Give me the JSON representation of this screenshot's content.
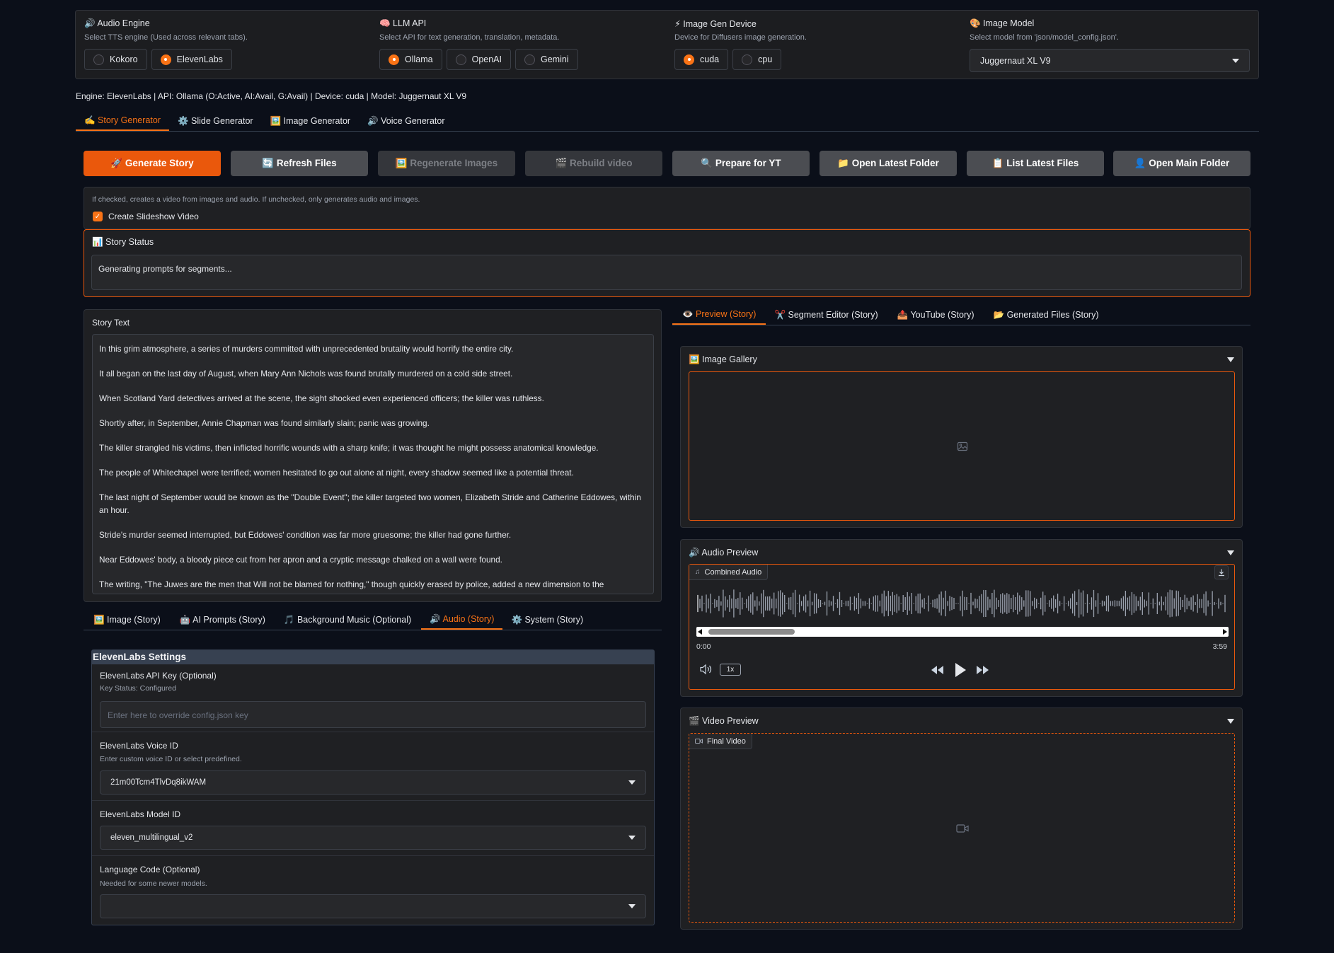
{
  "settings": {
    "audio_engine": {
      "title": "🔊 Audio Engine",
      "desc": "Select TTS engine (Used across relevant tabs).",
      "options": [
        "Kokoro",
        "ElevenLabs"
      ],
      "selected": "ElevenLabs"
    },
    "llm_api": {
      "title": "🧠 LLM API",
      "desc": "Select API for text generation, translation, metadata.",
      "options": [
        "Ollama",
        "OpenAI",
        "Gemini"
      ],
      "selected": "Ollama"
    },
    "device": {
      "title": "⚡ Image Gen Device",
      "desc": "Device for Diffusers image generation.",
      "options": [
        "cuda",
        "cpu"
      ],
      "selected": "cuda"
    },
    "image_model": {
      "title": "🎨 Image Model",
      "desc": "Select model from 'json/model_config.json'.",
      "value": "Juggernaut XL V9"
    }
  },
  "status_line": "Engine: ElevenLabs | API: Ollama (O:Active, AI:Avail, G:Avail) | Device: cuda | Model: Juggernaut XL V9",
  "main_tabs": [
    {
      "label": "✍️ Story Generator",
      "active": true
    },
    {
      "label": "⚙️ Slide Generator",
      "active": false
    },
    {
      "label": "🖼️ Image Generator",
      "active": false
    },
    {
      "label": "🔊 Voice Generator",
      "active": false
    }
  ],
  "buttons": {
    "generate": "🚀 Generate Story",
    "refresh": "🔄 Refresh Files",
    "regenerate": "🖼️ Regenerate Images",
    "rebuild": "🎬 Rebuild video",
    "prepare": "🔍 Prepare for YT",
    "open_latest": "📁 Open Latest Folder",
    "list_latest": "📋 List Latest Files",
    "open_main": "👤 Open Main Folder"
  },
  "slideshow": {
    "info": "If checked, creates a video from images and audio. If unchecked, only generates audio and images.",
    "label": "Create Slideshow Video",
    "checked": true
  },
  "story_status": {
    "title": "📊 Story Status",
    "text": "Generating prompts for segments..."
  },
  "story_text": {
    "title": "Story Text",
    "paragraphs": [
      "In this grim atmosphere, a series of murders committed with unprecedented brutality would horrify the entire city.",
      "It all began on the last day of August, when Mary Ann Nichols was found brutally murdered on a cold side street.",
      "When Scotland Yard detectives arrived at the scene, the sight shocked even experienced officers; the killer was ruthless.",
      "Shortly after, in September, Annie Chapman was found similarly slain; panic was growing.",
      "The killer strangled his victims, then inflicted horrific wounds with a sharp knife; it was thought he might possess anatomical knowledge.",
      "The people of Whitechapel were terrified; women hesitated to go out alone at night, every shadow seemed like a potential threat.",
      "The last night of September would be known as the \"Double Event\"; the killer targeted two women, Elizabeth Stride and Catherine Eddowes, within an hour.",
      "Stride's murder seemed interrupted, but Eddowes' condition was far more gruesome; the killer had gone further.",
      "Near Eddowes' body, a bloody piece cut from her apron and a cryptic message chalked on a wall were found.",
      "The writing, \"The Juwes are the men that Will not be blamed for nothing,\" though quickly erased by police, added a new dimension to the"
    ]
  },
  "sub_tabs": [
    {
      "label": "🖼️ Image (Story)",
      "active": false
    },
    {
      "label": "🤖 AI Prompts (Story)",
      "active": false
    },
    {
      "label": "🎵 Background Music (Optional)",
      "active": false
    },
    {
      "label": "🔊 Audio (Story)",
      "active": true
    },
    {
      "label": "⚙️ System (Story)",
      "active": false
    }
  ],
  "eleven": {
    "header": "ElevenLabs Settings",
    "api_key_label": "ElevenLabs API Key (Optional)",
    "api_key_status": "Key Status: Configured",
    "api_key_placeholder": "Enter here to override config.json key",
    "voice_label": "ElevenLabs Voice ID",
    "voice_desc": "Enter custom voice ID or select predefined.",
    "voice_value": "21m00Tcm4TlvDq8ikWAM",
    "model_label": "ElevenLabs Model ID",
    "model_value": "eleven_multilingual_v2",
    "lang_label": "Language Code (Optional)",
    "lang_desc": "Needed for some newer models.",
    "lang_value": ""
  },
  "right_tabs": [
    {
      "label": "👁️ Preview (Story)",
      "active": true
    },
    {
      "label": "✂️ Segment Editor (Story)",
      "active": false
    },
    {
      "label": "📤 YouTube (Story)",
      "active": false
    },
    {
      "label": "📂 Generated Files (Story)",
      "active": false
    }
  ],
  "image_gallery": {
    "title": "🖼️ Image Gallery"
  },
  "audio_preview": {
    "title": "🔊 Audio Preview",
    "badge": "Combined Audio",
    "time_start": "0:00",
    "time_end": "3:59",
    "speed": "1x",
    "scroll_fraction": 0.17
  },
  "video_preview": {
    "title": "🎬 Video Preview",
    "badge": "Final Video"
  },
  "colors": {
    "accent": "#f97316",
    "background": "#0b0f19",
    "panel": "#1f2023"
  }
}
